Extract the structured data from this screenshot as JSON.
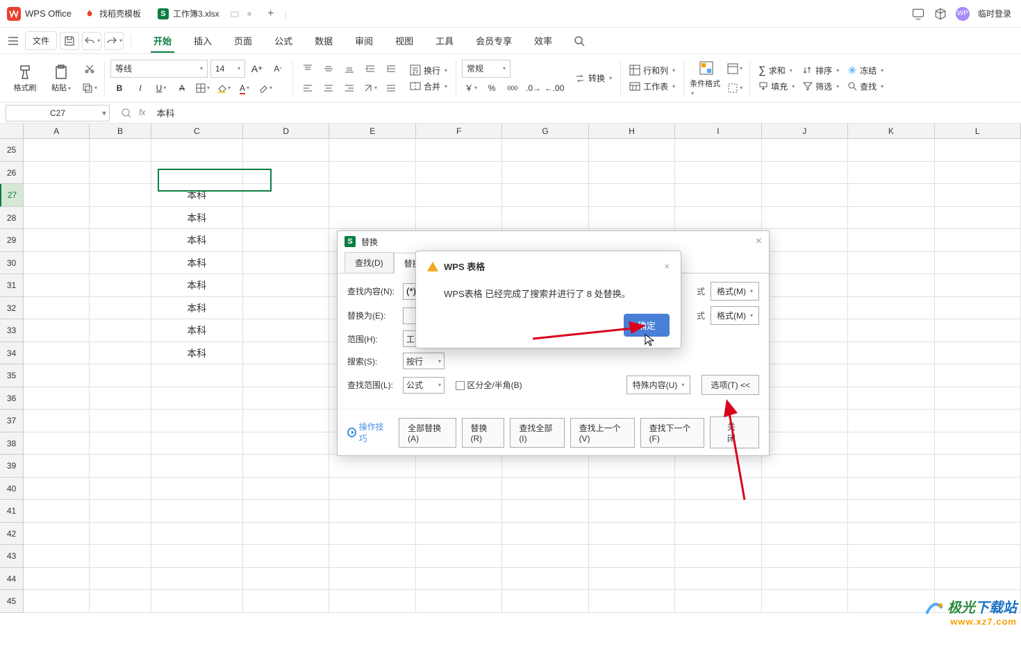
{
  "app": {
    "name": "WPS Office"
  },
  "tabs": [
    {
      "label": "找稻壳模板",
      "iconColor": "#e83f2d"
    },
    {
      "label": "工作簿3.xlsx",
      "iconText": "S",
      "active": true
    }
  ],
  "titlebar_right": {
    "login": "临时登录",
    "avatar": "WP"
  },
  "menu": {
    "file": "文件",
    "items": [
      "开始",
      "插入",
      "页面",
      "公式",
      "数据",
      "审阅",
      "视图",
      "工具",
      "会员专享",
      "效率"
    ],
    "active": "开始"
  },
  "ribbon": {
    "format_painter": "格式刷",
    "paste": "粘贴",
    "font": "等线",
    "size": "14",
    "general_fmt": "常规",
    "convert": "转换",
    "rows_cols": "行和列",
    "worksheet": "工作表",
    "cond_fmt": "条件格式",
    "autosum": "求和",
    "fill": "填充",
    "sort": "排序",
    "freeze": "冻结",
    "filter": "筛选",
    "find": "查找",
    "currency": "￥",
    "percent": "%",
    "comma_000": "000",
    "dec_inc": "⁰₊",
    "dec_dec": "⁰₋",
    "merge": "合并",
    "wrap": "换行"
  },
  "namebox": "C27",
  "formula": "本科",
  "columns": [
    "A",
    "B",
    "C",
    "D",
    "E",
    "F",
    "G",
    "H",
    "I",
    "J",
    "K",
    "L"
  ],
  "row_start": 25,
  "row_end": 45,
  "active_row": 27,
  "cell_data": {
    "27": "本科",
    "28": "本科",
    "29": "本科",
    "30": "本科",
    "31": "本科",
    "32": "本科",
    "33": "本科",
    "34": "本科"
  },
  "dialog1": {
    "title": "替换",
    "tab_find": "查找(D)",
    "tab_replace": "替换(P",
    "find_label": "查找内容(N):",
    "find_value": "(*)",
    "replace_label": "替换为(E):",
    "replace_value": "",
    "scope_label": "范围(H):",
    "scope_value": "工作表",
    "search_label": "搜索(S):",
    "search_value": "按行",
    "lookin_label": "查找范围(L):",
    "lookin_value": "公式",
    "match_width": "区分全/半角(B)",
    "fmt_desc": "式",
    "fmt_btn": "格式(M)",
    "special": "特殊内容(U)",
    "options": "选项(T)  <<",
    "tips": "操作技巧",
    "replace_all": "全部替换(A)",
    "replace_one": "替换(R)",
    "find_all": "查找全部(I)",
    "find_prev": "查找上一个(V)",
    "find_next": "查找下一个(F)",
    "close": "关闭"
  },
  "dialog2": {
    "title": "WPS 表格",
    "msg": "WPS表格 已经完成了搜索并进行了 8 处替换。",
    "ok": "确定"
  },
  "watermark": {
    "line1a": "极光",
    "line1b": "下载站",
    "url": "www.xz7.com"
  }
}
